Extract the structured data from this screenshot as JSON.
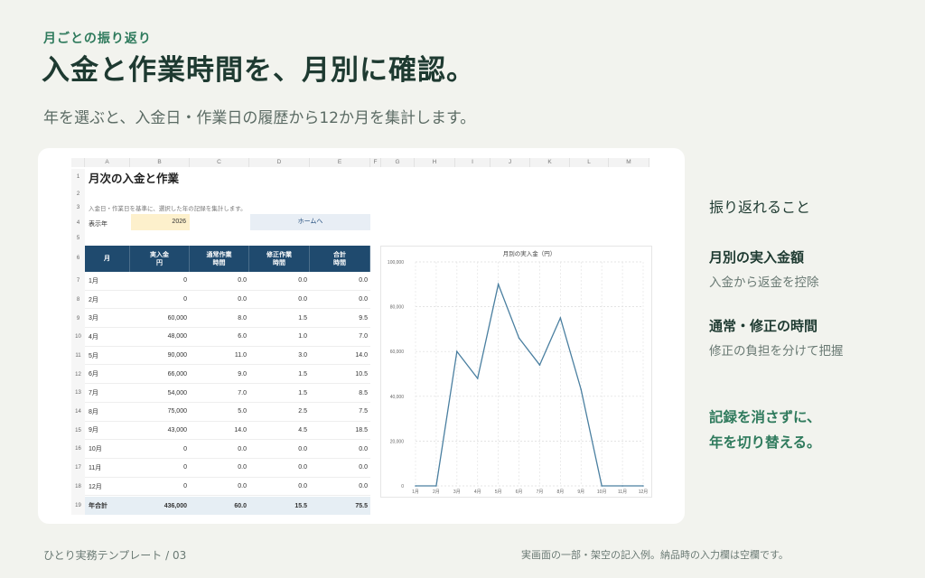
{
  "header": {
    "eyebrow": "月ごとの振り返り",
    "title": "入金と作業時間を、月別に確認。",
    "subtitle": "年を選ぶと、入金日・作業日の履歴から12か月を集計します。"
  },
  "sheet": {
    "columns": [
      "A",
      "B",
      "C",
      "D",
      "E",
      "F",
      "G",
      "H",
      "I",
      "J",
      "K",
      "L",
      "M"
    ],
    "rows": [
      "1",
      "2",
      "3",
      "4",
      "5",
      "6",
      "7",
      "8",
      "9",
      "10",
      "11",
      "12",
      "13",
      "14",
      "15",
      "16",
      "17",
      "18",
      "19"
    ],
    "title": "月次の入金と作業",
    "note": "入金日・作業日を基準に、選択した年の記録を集計します。",
    "year_label": "表示年",
    "year_value": "2026",
    "home_button": "ホームへ",
    "table_headers": [
      "月",
      "実入金\n円",
      "通常作業\n時間",
      "修正作業\n時間",
      "合計\n時間"
    ],
    "table_rows": [
      [
        "1月",
        "0",
        "0.0",
        "0.0",
        "0.0"
      ],
      [
        "2月",
        "0",
        "0.0",
        "0.0",
        "0.0"
      ],
      [
        "3月",
        "60,000",
        "8.0",
        "1.5",
        "9.5"
      ],
      [
        "4月",
        "48,000",
        "6.0",
        "1.0",
        "7.0"
      ],
      [
        "5月",
        "90,000",
        "11.0",
        "3.0",
        "14.0"
      ],
      [
        "6月",
        "66,000",
        "9.0",
        "1.5",
        "10.5"
      ],
      [
        "7月",
        "54,000",
        "7.0",
        "1.5",
        "8.5"
      ],
      [
        "8月",
        "75,000",
        "5.0",
        "2.5",
        "7.5"
      ],
      [
        "9月",
        "43,000",
        "14.0",
        "4.5",
        "18.5"
      ],
      [
        "10月",
        "0",
        "0.0",
        "0.0",
        "0.0"
      ],
      [
        "11月",
        "0",
        "0.0",
        "0.0",
        "0.0"
      ],
      [
        "12月",
        "0",
        "0.0",
        "0.0",
        "0.0"
      ]
    ],
    "total_row": [
      "年合計",
      "436,000",
      "60.0",
      "15.5",
      "75.5"
    ]
  },
  "chart_data": {
    "type": "line",
    "title": "月別の実入金（円）",
    "categories": [
      "1月",
      "2月",
      "3月",
      "4月",
      "5月",
      "6月",
      "7月",
      "8月",
      "9月",
      "10月",
      "11月",
      "12月"
    ],
    "values": [
      0,
      0,
      60000,
      48000,
      90000,
      66000,
      54000,
      75000,
      43000,
      0,
      0,
      0
    ],
    "ylim": [
      0,
      100000
    ],
    "yticks": [
      "0",
      "20,000",
      "40,000",
      "60,000",
      "80,000",
      "100,000"
    ],
    "grid": true,
    "line_color": "#4a7fa0"
  },
  "side": {
    "heading": "振り返れること",
    "items": [
      {
        "title": "月別の実入金額",
        "desc": "入金から返金を控除"
      },
      {
        "title": "通常・修正の時間",
        "desc": "修正の負担を分けて把握"
      }
    ],
    "accent_lines": [
      "記録を消さずに、",
      "年を切り替える。"
    ]
  },
  "footer": {
    "left": "ひとり実務テンプレート / 03",
    "right": "実画面の一部・架空の記入例。納品時の入力欄は空欄です。"
  }
}
